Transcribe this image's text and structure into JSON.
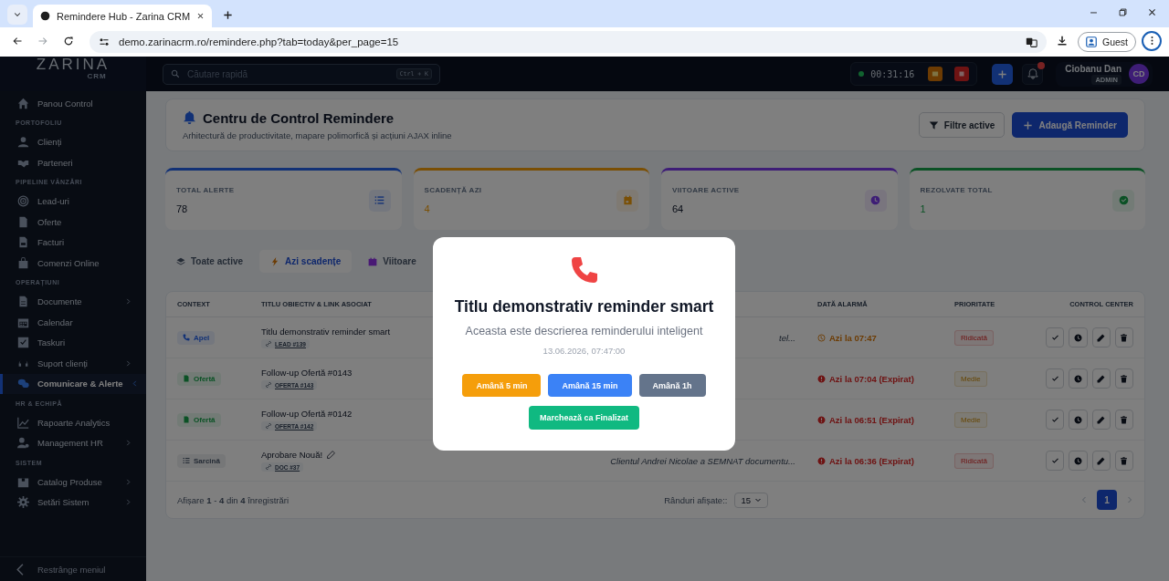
{
  "browser": {
    "tab_title": "Remindere Hub - Zarina CRM",
    "url": "demo.zarinacrm.ro/remindere.php?tab=today&per_page=15",
    "profile": "Guest"
  },
  "header": {
    "logo": "ZARINA",
    "logo_sub": "CRM",
    "search_placeholder": "Căutare rapidă",
    "shortcut": "Ctrl + K",
    "timer": "00:31:16",
    "user_name": "Ciobanu Dan",
    "user_role": "ADMIN",
    "initials": "CD"
  },
  "sidebar": {
    "items": [
      {
        "kind": "item",
        "label": "Panou Control",
        "arrow": false,
        "selected": false
      },
      {
        "kind": "section",
        "label": "PORTOFOLIU"
      },
      {
        "kind": "item",
        "label": "Clienți",
        "arrow": false,
        "selected": false
      },
      {
        "kind": "item",
        "label": "Parteneri",
        "arrow": false,
        "selected": false
      },
      {
        "kind": "section",
        "label": "PIPELINE VÂNZĂRI"
      },
      {
        "kind": "item",
        "label": "Lead-uri",
        "arrow": false,
        "selected": false
      },
      {
        "kind": "item",
        "label": "Oferte",
        "arrow": false,
        "selected": false
      },
      {
        "kind": "item",
        "label": "Facturi",
        "arrow": false,
        "selected": false
      },
      {
        "kind": "item",
        "label": "Comenzi Online",
        "arrow": false,
        "selected": false
      },
      {
        "kind": "section",
        "label": "OPERAȚIUNI"
      },
      {
        "kind": "item",
        "label": "Documente",
        "arrow": true,
        "selected": false
      },
      {
        "kind": "item",
        "label": "Calendar",
        "arrow": false,
        "selected": false
      },
      {
        "kind": "item",
        "label": "Taskuri",
        "arrow": false,
        "selected": false
      },
      {
        "kind": "item",
        "label": "Suport clienți",
        "arrow": true,
        "selected": false
      },
      {
        "kind": "item",
        "label": "Comunicare & Alerte",
        "arrow": true,
        "selected": true
      },
      {
        "kind": "section",
        "label": "HR & ECHIPĂ"
      },
      {
        "kind": "item",
        "label": "Rapoarte Analytics",
        "arrow": false,
        "selected": false
      },
      {
        "kind": "item",
        "label": "Management HR",
        "arrow": true,
        "selected": false
      },
      {
        "kind": "section",
        "label": "SISTEM"
      },
      {
        "kind": "item",
        "label": "Catalog Produse",
        "arrow": true,
        "selected": false
      },
      {
        "kind": "item",
        "label": "Setări Sistem",
        "arrow": true,
        "selected": false
      }
    ],
    "collapse": "Restrânge meniul"
  },
  "page": {
    "title": "Centru de Control Remindere",
    "subtitle": "Arhitectură de productivitate, mapare polimorfică și acțiuni AJAX inline",
    "filter_button": "Filtre active",
    "add_button": "Adaugă Reminder"
  },
  "stats": [
    {
      "label": "TOTAL ALERTE",
      "value": "78"
    },
    {
      "label": "SCADENȚĂ AZI",
      "value": "4"
    },
    {
      "label": "VIITOARE ACTIVE",
      "value": "64"
    },
    {
      "label": "REZOLVATE TOTAL",
      "value": "1"
    }
  ],
  "tabs": [
    {
      "label": "Toate active",
      "selected": false
    },
    {
      "label": "Azi scadențe",
      "selected": true
    },
    {
      "label": "Viitoare",
      "selected": false
    }
  ],
  "table": {
    "columns": [
      "CONTEXT",
      "TITLU OBIECTIV & LINK ASOCIAT",
      "DATĂ ALARMĂ",
      "PRIORITATE",
      "CONTROL CENTER"
    ],
    "rows": [
      {
        "context": {
          "label": "Apel",
          "kind": "call"
        },
        "title": "Titlu demonstrativ reminder smart",
        "link": "LEAD #139",
        "description": "tel...",
        "alarm": {
          "kind": "upcoming",
          "text": "Azi la 07:47"
        },
        "priority": {
          "label": "Ridicată",
          "kind": "high"
        }
      },
      {
        "context": {
          "label": "Ofertă",
          "kind": "offer"
        },
        "title": "Follow-up Ofertă #0143",
        "link": "OFERTA #143",
        "alarm": {
          "kind": "expired",
          "text": "Azi la 07:04 (Expirat)"
        },
        "priority": {
          "label": "Medie",
          "kind": "medium"
        }
      },
      {
        "context": {
          "label": "Ofertă",
          "kind": "offer"
        },
        "title": "Follow-up Ofertă #0142",
        "link": "OFERTA #142",
        "alarm": {
          "kind": "expired",
          "text": "Azi la 06:51 (Expirat)"
        },
        "priority": {
          "label": "Medie",
          "kind": "medium"
        }
      },
      {
        "context": {
          "label": "Sarcină",
          "kind": "task"
        },
        "title": "Aprobare Nouă!",
        "link": "DOC #37",
        "description": "Clientul Andrei Nicolae a SEMNAT documentu...",
        "alarm": {
          "kind": "expired",
          "text": "Azi la 06:36 (Expirat)"
        },
        "priority": {
          "label": "Ridicată",
          "kind": "high"
        }
      }
    ]
  },
  "footer": {
    "info": "Afișare **1** - **4** din **4** înregistrări",
    "rows_label": "Rânduri afișate::",
    "per_page": "15",
    "page": "1"
  },
  "modal": {
    "title": "Titlu demonstrativ reminder smart",
    "description": "Aceasta este descrierea reminderului inteligent",
    "datetime": "13.06.2026, 07:47:00",
    "buttons": [
      {
        "label": "Amână 5 min",
        "color": "#f59e0b"
      },
      {
        "label": "Amână 15 min",
        "color": "#3b82f6"
      },
      {
        "label": "Amână 1h",
        "color": "#64748b"
      }
    ],
    "finish": "Marchează ca Finalizat"
  }
}
